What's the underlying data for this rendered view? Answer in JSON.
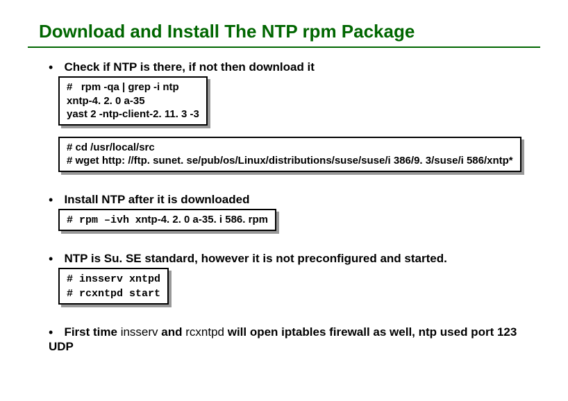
{
  "title": "Download and Install The NTP rpm Package",
  "bullets": {
    "b1": {
      "text": "Check if NTP is there, if not then download it",
      "code1": "#   rpm -qa | grep -i ntp\nxntp-4. 2. 0 a-35\nyast 2 -ntp-client-2. 11. 3 -3",
      "code2": "# cd /usr/local/src\n# wget http: //ftp. sunet. se/pub/os/Linux/distributions/suse/suse/i 386/9. 3/suse/i 586/xntp*"
    },
    "b2": {
      "text": "Install NTP after it is downloaded",
      "code_prefix": "# rpm –ivh ",
      "code_rest": "xntp-4. 2. 0 a-35. i 586. rpm"
    },
    "b3": {
      "text": "NTP is Su. SE standard, however it is not preconfigured and started.",
      "code": "# insserv xntpd\n# rcxntpd start"
    },
    "b4": {
      "prefix": "First time ",
      "mid1": "insserv ",
      "mid2": "and ",
      "mid3": "rcxntpd ",
      "rest": "will open iptables firewall as well, ntp used port 123 UDP"
    }
  }
}
